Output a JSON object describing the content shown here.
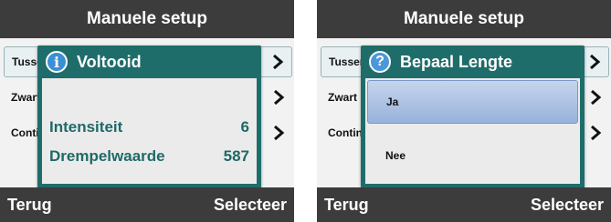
{
  "screens": [
    {
      "header": {
        "title": "Manuele setup"
      },
      "menu": [
        {
          "label": "Tussenruimte",
          "selected": true
        },
        {
          "label": "Zwart merkteken",
          "selected": false
        },
        {
          "label": "Continu",
          "selected": false
        }
      ],
      "dialog": {
        "icon": "info-icon",
        "icon_glyph": "i",
        "title": "Voltooid",
        "rows": [
          {
            "label": "Intensiteit",
            "value": "6"
          },
          {
            "label": "Drempelwaarde",
            "value": "587"
          }
        ]
      },
      "footer": {
        "left": "Terug",
        "right": "Selecteer"
      }
    },
    {
      "header": {
        "title": "Manuele setup"
      },
      "menu": [
        {
          "label": "Tussenruimte",
          "selected": true
        },
        {
          "label": "Zwart merkteken",
          "selected": false
        },
        {
          "label": "Continu",
          "selected": false
        }
      ],
      "dialog": {
        "icon": "question-icon",
        "icon_glyph": "?",
        "title": "Bepaal Lengte",
        "options": [
          {
            "label": "Ja",
            "selected": true
          },
          {
            "label": "Nee",
            "selected": false
          }
        ]
      },
      "footer": {
        "left": "Terug",
        "right": "Selecteer"
      }
    }
  ],
  "colors": {
    "bar": "#3c3c3c",
    "dialog_frame": "#1f6d6a",
    "dialog_text": "#1e6a66",
    "selection": "#98b2dc"
  }
}
